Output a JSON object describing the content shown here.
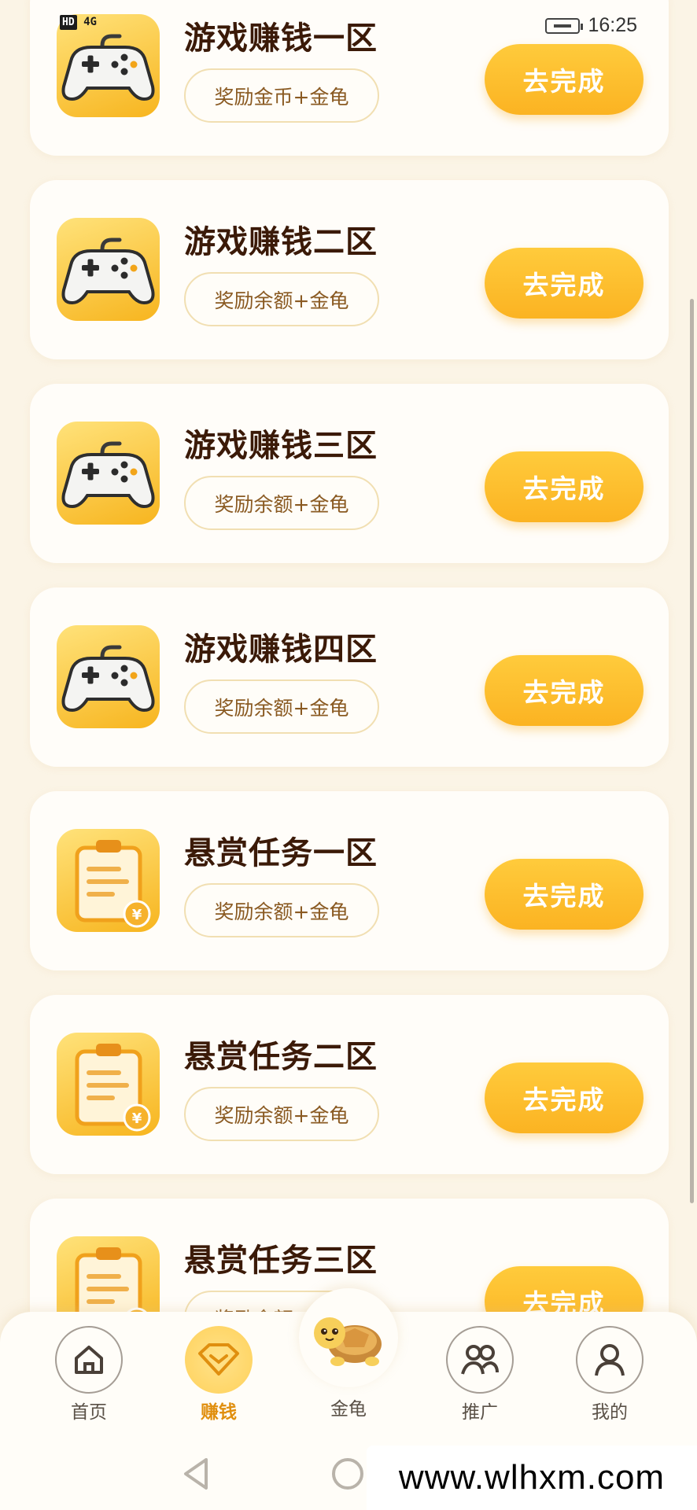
{
  "status": {
    "time": "16:25",
    "network": "4G",
    "hd": "HD"
  },
  "tasks": [
    {
      "title": "游戏赚钱一区",
      "reward": "奖励金币+金龟",
      "button": "去完成",
      "icon": "gamepad-icon"
    },
    {
      "title": "游戏赚钱二区",
      "reward": "奖励余额+金龟",
      "button": "去完成",
      "icon": "gamepad-icon"
    },
    {
      "title": "游戏赚钱三区",
      "reward": "奖励余额+金龟",
      "button": "去完成",
      "icon": "gamepad-icon"
    },
    {
      "title": "游戏赚钱四区",
      "reward": "奖励余额+金龟",
      "button": "去完成",
      "icon": "gamepad-icon"
    },
    {
      "title": "悬赏任务一区",
      "reward": "奖励余额+金龟",
      "button": "去完成",
      "icon": "clipboard-coin-icon"
    },
    {
      "title": "悬赏任务二区",
      "reward": "奖励余额+金龟",
      "button": "去完成",
      "icon": "clipboard-coin-icon"
    },
    {
      "title": "悬赏任务三区",
      "reward": "奖励余额+金龟",
      "button": "去完成",
      "icon": "clipboard-coin-icon"
    }
  ],
  "tabs": {
    "home": "首页",
    "earn": "赚钱",
    "turtle": "金龟",
    "promote": "推广",
    "mine": "我的"
  },
  "colors": {
    "accent": "#fbb322",
    "active_tab": "#e08f0f",
    "title": "#3b1a08"
  },
  "watermark": "www.wlhxm.com"
}
